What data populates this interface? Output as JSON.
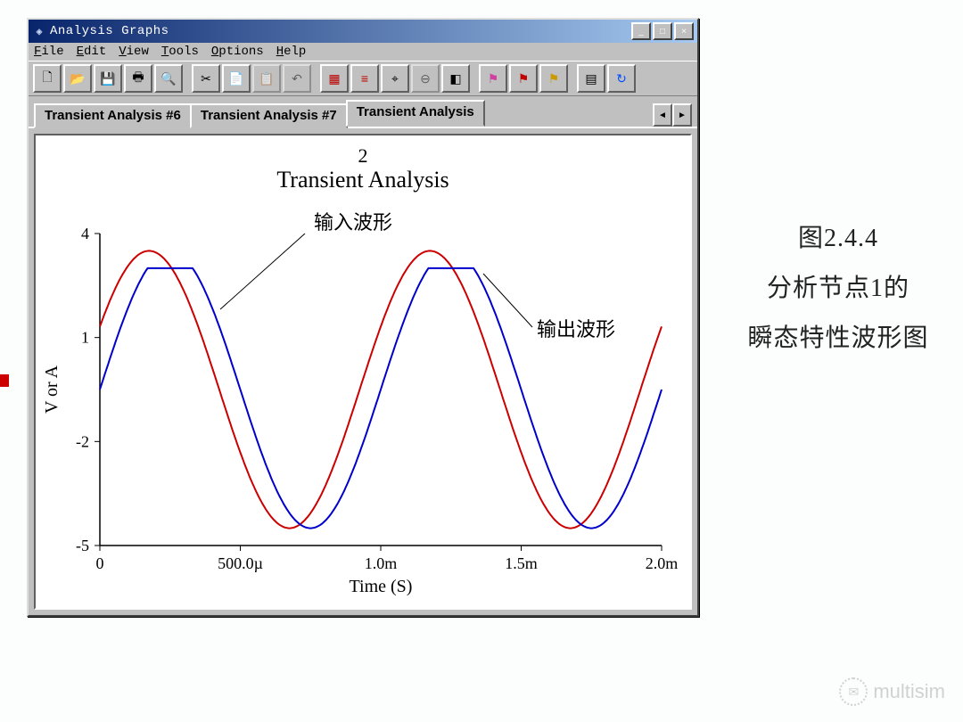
{
  "window": {
    "title": "Analysis Graphs",
    "minimize": "_",
    "maximize": "□",
    "close": "×"
  },
  "menubar": {
    "file": "File",
    "edit": "Edit",
    "view": "View",
    "tools": "Tools",
    "options": "Options",
    "help": "Help"
  },
  "toolbar_icons": {
    "new": "new-file-icon",
    "open": "open-folder-icon",
    "save": "save-disk-icon",
    "print": "printer-icon",
    "preview": "print-preview-icon",
    "cut": "scissors-icon",
    "copy": "copy-icon",
    "paste": "paste-icon",
    "undo": "undo-icon",
    "grid": "grid-icon",
    "list": "legend-icon",
    "cursor": "cursor-icon",
    "zoom": "zoom-out-icon",
    "front": "bring-front-icon",
    "tag1": "marker-pink-icon",
    "tag2": "marker-red-icon",
    "tag3": "marker-yellow-icon",
    "props": "properties-icon",
    "blue": "refresh-blue-icon"
  },
  "tabs": {
    "tab6": "Transient Analysis #6",
    "tab7": "Transient Analysis #7",
    "tab_active": "Transient Analysis",
    "scroll_left": "◄",
    "scroll_right": "►"
  },
  "chart_data": {
    "type": "line",
    "supertitle": "2",
    "title": "Transient Analysis",
    "xlabel": "Time (S)",
    "ylabel": "V or A",
    "xticks": [
      0,
      0.0005,
      0.001,
      0.0015,
      0.002
    ],
    "xtick_labels": [
      "0",
      "500.0µ",
      "1.0m",
      "1.5m",
      "2.0m"
    ],
    "yticks": [
      -5,
      -2,
      1,
      4
    ],
    "ylim": [
      -5,
      4
    ],
    "xlim": [
      0,
      0.002
    ],
    "series": [
      {
        "name": "输出波形",
        "color": "#cc0000",
        "period_s": 0.001,
        "amplitude": 4.0,
        "offset": -0.5,
        "note": "sine, approx y = -0.5 + 4*sin(2π·1000·t + 0.15π)"
      },
      {
        "name": "输入波形",
        "color": "#0000cc",
        "period_s": 0.001,
        "amplitude": 4.0,
        "offset": -0.5,
        "clip_top": 3.0,
        "note": "sine clipped at ~3, approx y = min(3, -0.5 + 4*sin(2π·1000·t))"
      }
    ],
    "annotations": [
      {
        "text": "输入波形",
        "points_to_series": 1
      },
      {
        "text": "输出波形",
        "points_to_series": 0
      }
    ]
  },
  "side_caption": {
    "line1": "图2.4.4",
    "line2": "分析节点1的",
    "line3": "瞬态特性波形图"
  },
  "watermark": {
    "text": "multisim"
  }
}
